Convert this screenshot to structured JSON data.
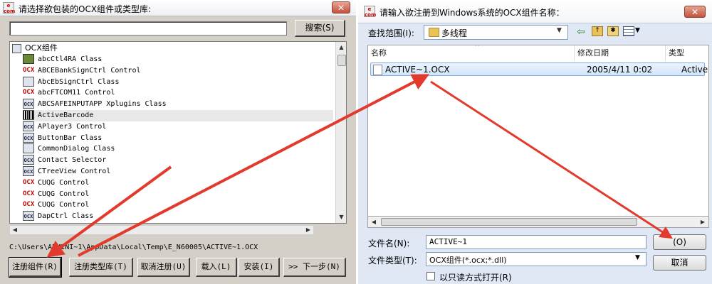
{
  "left_dialog": {
    "title": "请选择欲包装的OCX组件或类型库:",
    "search_label": "搜索(S)",
    "search_value": "",
    "tree_root": "OCX组件",
    "items": [
      {
        "label": "abcCtl4RA Class",
        "icon": "green-tile-icon"
      },
      {
        "label": "ABCEBankSignCtrl Control",
        "icon": "ocx-icon"
      },
      {
        "label": "AbcEbSignCtrl Class",
        "icon": "signature-icon"
      },
      {
        "label": "abcFTCOM11 Control",
        "icon": "ocx-icon"
      },
      {
        "label": "ABCSAFEINPUTAPP Xplugins Class",
        "icon": "ocx-box-icon"
      },
      {
        "label": "ActiveBarcode",
        "icon": "barcode-icon"
      },
      {
        "label": "APlayer3 Control",
        "icon": "ocx-box-icon"
      },
      {
        "label": "ButtonBar Class",
        "icon": "ocx-box-icon"
      },
      {
        "label": "CommonDialog Class",
        "icon": "dialog-icon"
      },
      {
        "label": "Contact Selector",
        "icon": "ocx-box-icon"
      },
      {
        "label": "CTreeView Control",
        "icon": "ocx-box-icon"
      },
      {
        "label": "CUQG Control",
        "icon": "ocx-icon"
      },
      {
        "label": "CUQG Control",
        "icon": "ocx-icon"
      },
      {
        "label": "CUQG Control",
        "icon": "ocx-icon"
      },
      {
        "label": "DapCtrl Class",
        "icon": "ocx-box-icon"
      }
    ],
    "path": "C:\\Users\\ADMINI~1\\AppData\\Local\\Temp\\E_N60005\\ACTIVE~1.OCX",
    "buttons": {
      "register": "注册组件(R)",
      "register_typelib": "注册类型库(T)",
      "unregister": "取消注册(U)",
      "load": "载入(L)",
      "install": "安装(I)",
      "next": ">> 下一步(N)"
    }
  },
  "right_dialog": {
    "title": "请输入欲注册到Windows系统的OCX组件名称：",
    "look_in_label": "查找范围(I):",
    "look_in_value": "多线程",
    "columns": [
      "名称",
      "修改日期",
      "类型"
    ],
    "files": [
      {
        "name": "ACTIVE~1.OCX",
        "date": "2005/4/11 0:02",
        "type": "Active"
      }
    ],
    "filename_label": "文件名(N):",
    "filename_value": "ACTIVE~1",
    "filetype_label": "文件类型(T):",
    "filetype_value": "OCX组件(*.ocx;*.dll)",
    "readonly_label": "以只读方式打开(R)",
    "open_button": "(O)",
    "cancel_button": "取消"
  },
  "colors": {
    "annotation_arrow": "#e23b2e",
    "selection_fill": "#d3e6fb"
  }
}
